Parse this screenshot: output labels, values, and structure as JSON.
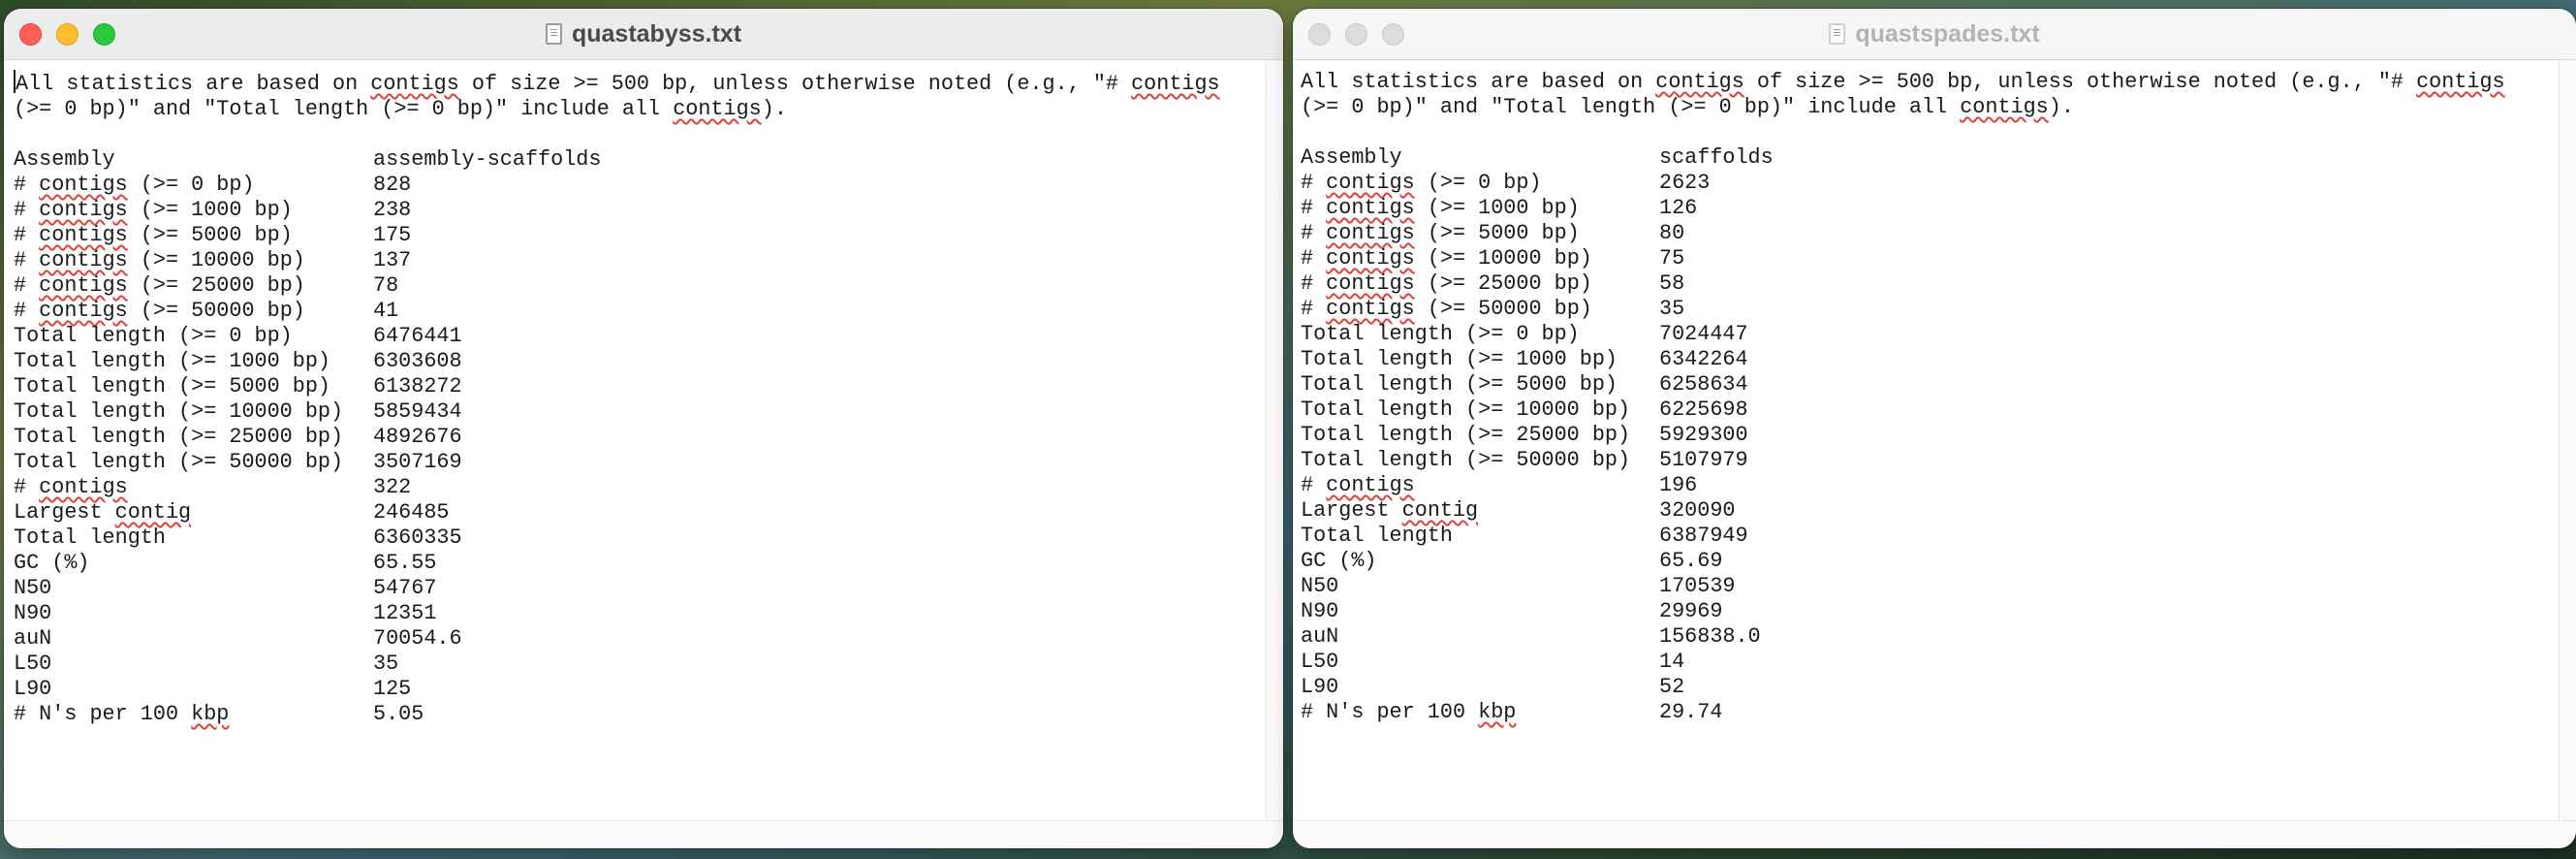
{
  "windows": [
    {
      "title": "quastabyss.txt",
      "active": true,
      "intro": "All statistics are based on contigs of size >= 500 bp, unless otherwise noted (e.g., \"# contigs (>= 0 bp)\" and \"Total length (>= 0 bp)\" include all contigs).",
      "header": {
        "label": "Assembly",
        "value": "assembly-scaffolds"
      },
      "rows": [
        {
          "label": "# contigs (>= 0 bp)",
          "value": "828"
        },
        {
          "label": "# contigs (>= 1000 bp)",
          "value": "238"
        },
        {
          "label": "# contigs (>= 5000 bp)",
          "value": "175"
        },
        {
          "label": "# contigs (>= 10000 bp)",
          "value": "137"
        },
        {
          "label": "# contigs (>= 25000 bp)",
          "value": "78"
        },
        {
          "label": "# contigs (>= 50000 bp)",
          "value": "41"
        },
        {
          "label": "Total length (>= 0 bp)",
          "value": "6476441"
        },
        {
          "label": "Total length (>= 1000 bp)",
          "value": "6303608"
        },
        {
          "label": "Total length (>= 5000 bp)",
          "value": "6138272"
        },
        {
          "label": "Total length (>= 10000 bp)",
          "value": "5859434"
        },
        {
          "label": "Total length (>= 25000 bp)",
          "value": "4892676"
        },
        {
          "label": "Total length (>= 50000 bp)",
          "value": "3507169"
        },
        {
          "label": "# contigs",
          "value": "322"
        },
        {
          "label": "Largest contig",
          "value": "246485"
        },
        {
          "label": "Total length",
          "value": "6360335"
        },
        {
          "label": "GC (%)",
          "value": "65.55"
        },
        {
          "label": "N50",
          "value": "54767"
        },
        {
          "label": "N90",
          "value": "12351"
        },
        {
          "label": "auN",
          "value": "70054.6"
        },
        {
          "label": "L50",
          "value": "35"
        },
        {
          "label": "L90",
          "value": "125"
        },
        {
          "label": "# N's per 100 kbp",
          "value": "5.05"
        }
      ]
    },
    {
      "title": "quastspades.txt",
      "active": false,
      "intro": "All statistics are based on contigs of size >= 500 bp, unless otherwise noted (e.g., \"# contigs (>= 0 bp)\" and \"Total length (>= 0 bp)\" include all contigs).",
      "header": {
        "label": "Assembly",
        "value": "scaffolds"
      },
      "rows": [
        {
          "label": "# contigs (>= 0 bp)",
          "value": "2623"
        },
        {
          "label": "# contigs (>= 1000 bp)",
          "value": "126"
        },
        {
          "label": "# contigs (>= 5000 bp)",
          "value": "80"
        },
        {
          "label": "# contigs (>= 10000 bp)",
          "value": "75"
        },
        {
          "label": "# contigs (>= 25000 bp)",
          "value": "58"
        },
        {
          "label": "# contigs (>= 50000 bp)",
          "value": "35"
        },
        {
          "label": "Total length (>= 0 bp)",
          "value": "7024447"
        },
        {
          "label": "Total length (>= 1000 bp)",
          "value": "6342264"
        },
        {
          "label": "Total length (>= 5000 bp)",
          "value": "6258634"
        },
        {
          "label": "Total length (>= 10000 bp)",
          "value": "6225698"
        },
        {
          "label": "Total length (>= 25000 bp)",
          "value": "5929300"
        },
        {
          "label": "Total length (>= 50000 bp)",
          "value": "5107979"
        },
        {
          "label": "# contigs",
          "value": "196"
        },
        {
          "label": "Largest contig",
          "value": "320090"
        },
        {
          "label": "Total length",
          "value": "6387949"
        },
        {
          "label": "GC (%)",
          "value": "65.69"
        },
        {
          "label": "N50",
          "value": "170539"
        },
        {
          "label": "N90",
          "value": "29969"
        },
        {
          "label": "auN",
          "value": "156838.0"
        },
        {
          "label": "L50",
          "value": "14"
        },
        {
          "label": "L90",
          "value": "52"
        },
        {
          "label": "# N's per 100 kbp",
          "value": "29.74"
        }
      ]
    }
  ],
  "spellcheck_words": [
    "contigs",
    "contig",
    "kbp"
  ],
  "colors": {
    "close": "#ff5f57",
    "minimize": "#febc2e",
    "maximize": "#28c840",
    "spell_underline": "#e0413b"
  }
}
